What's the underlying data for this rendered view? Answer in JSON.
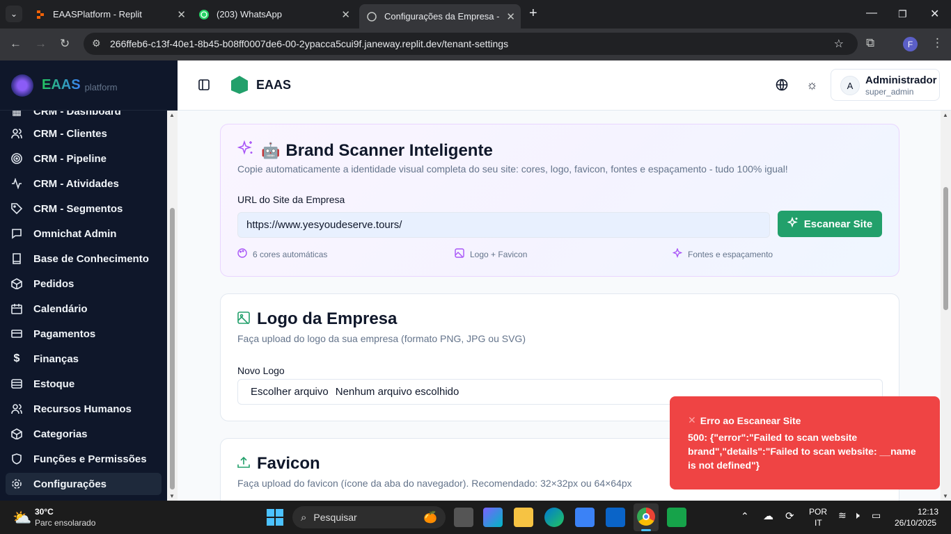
{
  "browser": {
    "tabs": [
      {
        "title": "EAASPlatform - Replit"
      },
      {
        "title": "(203) WhatsApp"
      },
      {
        "title": "Configurações da Empresa - EA"
      }
    ],
    "url": "266ffeb6-c13f-40e1-8b45-b08ff0007de6-00-2ypacca5cui9f.janeway.replit.dev/tenant-settings",
    "profile_initial": "F"
  },
  "sidebar": {
    "brand_name": "EAAS",
    "brand_sub": "platform",
    "partial_item": "CRM - Dashboard",
    "items": [
      {
        "label": "CRM - Clientes",
        "icon": "users-icon"
      },
      {
        "label": "CRM - Pipeline",
        "icon": "target-icon"
      },
      {
        "label": "CRM - Atividades",
        "icon": "activity-icon"
      },
      {
        "label": "CRM - Segmentos",
        "icon": "tag-icon"
      },
      {
        "label": "Omnichat Admin",
        "icon": "message-icon"
      },
      {
        "label": "Base de Conhecimento",
        "icon": "book-icon"
      },
      {
        "label": "Pedidos",
        "icon": "package-icon"
      },
      {
        "label": "Calendário",
        "icon": "calendar-icon"
      },
      {
        "label": "Pagamentos",
        "icon": "credit-card-icon"
      },
      {
        "label": "Finanças",
        "icon": "dollar-icon"
      },
      {
        "label": "Estoque",
        "icon": "database-icon"
      },
      {
        "label": "Recursos Humanos",
        "icon": "user-group-icon"
      },
      {
        "label": "Categorias",
        "icon": "box-icon"
      },
      {
        "label": "Funções e Permissões",
        "icon": "shield-icon"
      },
      {
        "label": "Configurações",
        "icon": "gear-icon"
      }
    ]
  },
  "header": {
    "app_name": "EAAS",
    "user_name": "Administrador",
    "user_role": "super_admin",
    "avatar_initial": "A"
  },
  "brand_scanner": {
    "emoji": "🤖",
    "title": "Brand Scanner Inteligente",
    "subtitle": "Copie automaticamente a identidade visual completa do seu site: cores, logo, favicon, fontes e espaçamento - tudo 100% igual!",
    "url_label": "URL do Site da Empresa",
    "url_value": "https://www.yesyoudeserve.tours/",
    "scan_button": "Escanear Site",
    "features": [
      "6 cores automáticas",
      "Logo + Favicon",
      "Fontes e espaçamento"
    ]
  },
  "logo_section": {
    "title": "Logo da Empresa",
    "subtitle": "Faça upload do logo da sua empresa (formato PNG, JPG ou SVG)",
    "field_label": "Novo Logo",
    "file_button": "Escolher arquivo",
    "file_status": "Nenhum arquivo escolhido"
  },
  "favicon_section": {
    "title": "Favicon",
    "subtitle": "Faça upload do favicon (ícone da aba do navegador). Recomendado: 32×32px ou 64×64px"
  },
  "toast": {
    "title": "Erro ao Escanear Site",
    "message": "500: {\"error\":\"Failed to scan website brand\",\"details\":\"Failed to scan website: __name is not defined\"}"
  },
  "taskbar": {
    "temp": "30°C",
    "weather": "Parc ensolarado",
    "search": "Pesquisar",
    "lang1": "POR",
    "lang2": "IT",
    "time": "12:13",
    "date": "26/10/2025"
  },
  "colors": {
    "accent": "#22a06b",
    "toast": "#ef4444",
    "sidebar": "#0f172a",
    "purple": "#a855f7"
  }
}
